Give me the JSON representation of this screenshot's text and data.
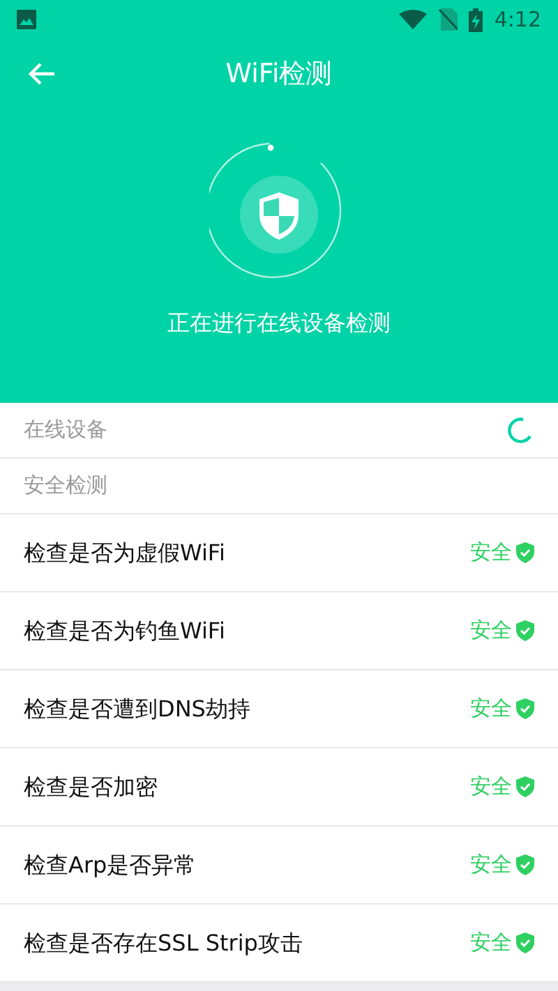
{
  "status_bar": {
    "time": "4:12"
  },
  "header": {
    "title": "WiFi检测",
    "message": "正在进行在线设备检测"
  },
  "sections": [
    {
      "label": "在线设备",
      "loading": true
    },
    {
      "label": "安全检测",
      "loading": false
    }
  ],
  "checks": [
    {
      "label": "检查是否为虚假WiFi",
      "result": "安全",
      "kind": "safe"
    },
    {
      "label": "检查是否为钓鱼WiFi",
      "result": "安全",
      "kind": "safe"
    },
    {
      "label": "检查是否遭到DNS劫持",
      "result": "安全",
      "kind": "safe"
    },
    {
      "label": "检查是否加密",
      "result": "安全",
      "kind": "safe"
    },
    {
      "label": "检查Arp是否异常",
      "result": "安全",
      "kind": "safe"
    },
    {
      "label": "检查是否存在SSL Strip攻击",
      "result": "安全",
      "kind": "safe"
    }
  ]
}
